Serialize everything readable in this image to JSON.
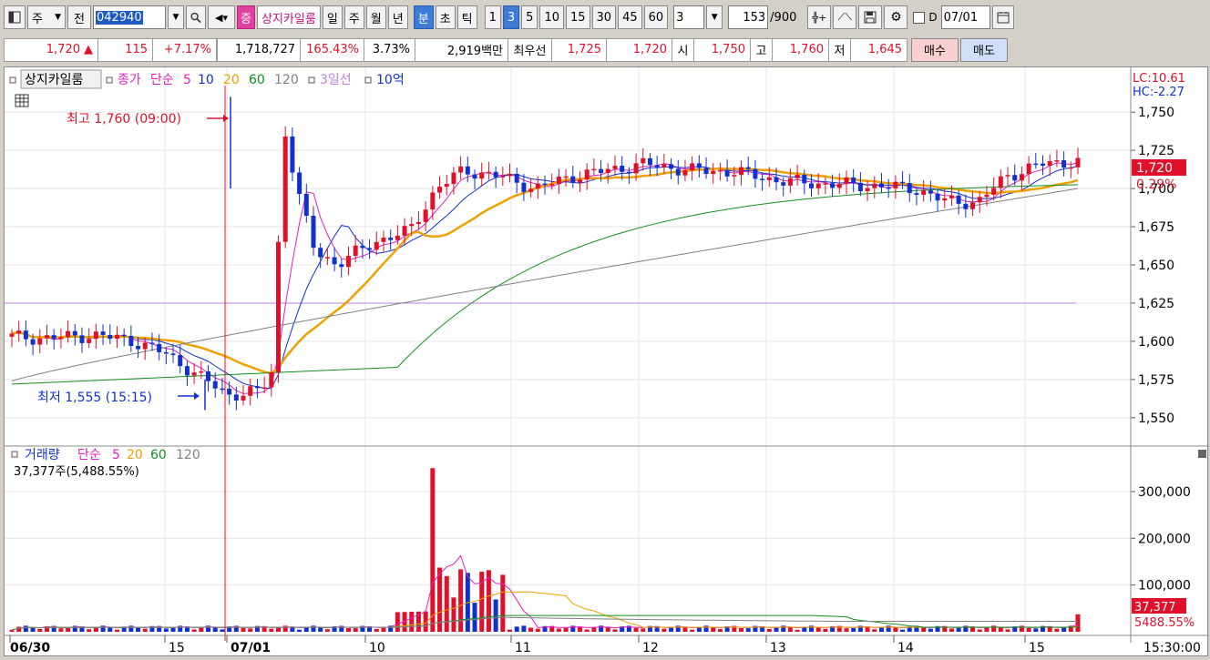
{
  "toolbar": {
    "market": "주",
    "market2": "전",
    "code": "042940",
    "stock_name": "상지카일룸",
    "badge": "증",
    "periods": [
      "일",
      "주",
      "월",
      "년"
    ],
    "units": [
      "분",
      "초",
      "틱"
    ],
    "active_unit": "분",
    "intervals": [
      "1",
      "3",
      "5",
      "10",
      "15",
      "30",
      "45",
      "60"
    ],
    "active_interval": "3",
    "interval_value": "3",
    "count": "153",
    "count_total": "/900",
    "date_checkbox_label": "D",
    "date": "07/01"
  },
  "quote": {
    "price": "1,720",
    "change": "115",
    "change_pct": "+7.17%",
    "volume": "1,718,727",
    "vol_ratio": "165.43%",
    "turnover": "3.73%",
    "amount": "2,919백만",
    "best_label": "최우선",
    "best_ask": "1,725",
    "best_bid": "1,720",
    "open_label": "시",
    "open": "1,750",
    "high_label": "고",
    "high": "1,760",
    "low_label": "저",
    "low": "1,645",
    "buy_label": "매수",
    "sell_label": "매도"
  },
  "legend": {
    "name": "상지카일룸",
    "close_label": "종가",
    "ma_label": "단순",
    "ma": [
      "5",
      "10",
      "20",
      "60",
      "120"
    ],
    "line3": "3일선",
    "amount": "10억",
    "vol_name": "거래량",
    "vol_ma": [
      "5",
      "20",
      "60",
      "120"
    ],
    "vol_info": "37,377주(5,488.55%)"
  },
  "annotations": {
    "high": "최고 1,760 (09:00)",
    "low": "최저 1,555 (15:15)",
    "lc": "LC:10.61",
    "hc": "HC:-2.27",
    "price_tag": "1,720",
    "pct_tag": "0.29%",
    "vol_tag": "37,377",
    "vol_pct_tag": "5488.55%"
  },
  "time_axis": {
    "labels": [
      "06/30",
      "15",
      "07/01",
      "10",
      "11",
      "12",
      "13",
      "14",
      "15"
    ],
    "clock": "15:30:00"
  },
  "colors": {
    "up": "#e0102a",
    "down": "#1030d0",
    "ma5": "#e020c0",
    "ma10": "#1030d0",
    "ma20": "#f0a000",
    "ma60": "#109020",
    "ma120": "#808080",
    "line3": "#c080e0"
  },
  "chart_data": {
    "type": "candlestick",
    "price_axis": [
      "1,750",
      "1,725",
      "1,700",
      "1,675",
      "1,650",
      "1,625",
      "1,600",
      "1,575",
      "1,550"
    ],
    "ylim": [
      1535,
      1765
    ],
    "volume_axis": [
      "300,000",
      "200,000",
      "100,000"
    ],
    "volume_ylim": [
      0,
      370000
    ],
    "reference_line": 1625,
    "last_close": 1720,
    "day_high": 1760,
    "day_low": 1555,
    "last_volume": 37377
  }
}
